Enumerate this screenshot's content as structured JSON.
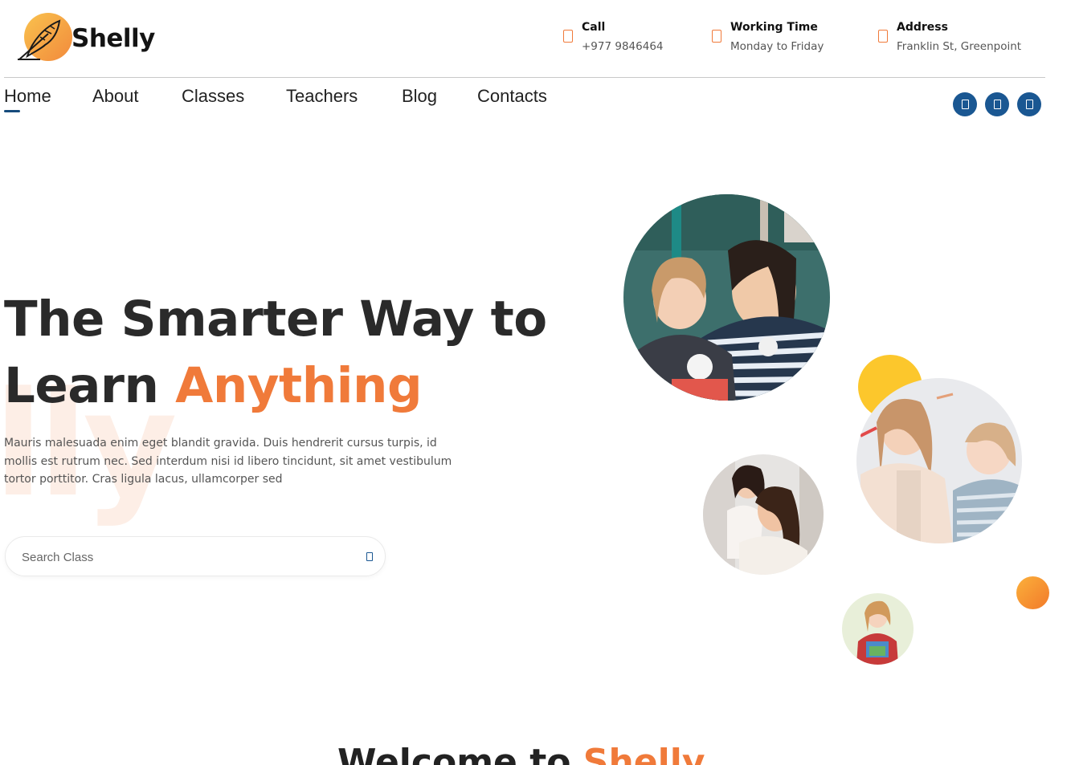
{
  "brand": {
    "name": "Shelly",
    "accent": "#f07a3a",
    "primary": "#1a5792"
  },
  "contacts": [
    {
      "title": "Call",
      "value": "+977 9846464",
      "icon": "phone-icon"
    },
    {
      "title": "Working Time",
      "value": "Monday to Friday",
      "icon": "clock-icon"
    },
    {
      "title": "Address",
      "value": "Franklin St, Greenpoint",
      "icon": "map-pin-icon"
    }
  ],
  "nav": {
    "active": "Home",
    "items": [
      "Home",
      "About",
      "Classes",
      "Teachers",
      "Blog",
      "Contacts"
    ]
  },
  "socials": [
    "facebook-icon",
    "twitter-icon",
    "instagram-icon"
  ],
  "hero": {
    "title_line1": "The Smarter Way to",
    "title_line2_plain": "Learn ",
    "title_line2_highlight": "Anything",
    "watermark": "lly",
    "text": "Mauris malesuada enim eget blandit gravida. Duis hendrerit cursus turpis, id mollis est rutrum nec. Sed interdum nisi id libero tincidunt, sit amet vestibulum tortor porttitor. Cras ligula lacus, ullamcorper sed"
  },
  "search": {
    "placeholder": "Search Class",
    "value": "",
    "icon": "search-icon"
  },
  "next_section": {
    "heading_plain": "Welcome to ",
    "heading_highlight": "Shelly"
  }
}
